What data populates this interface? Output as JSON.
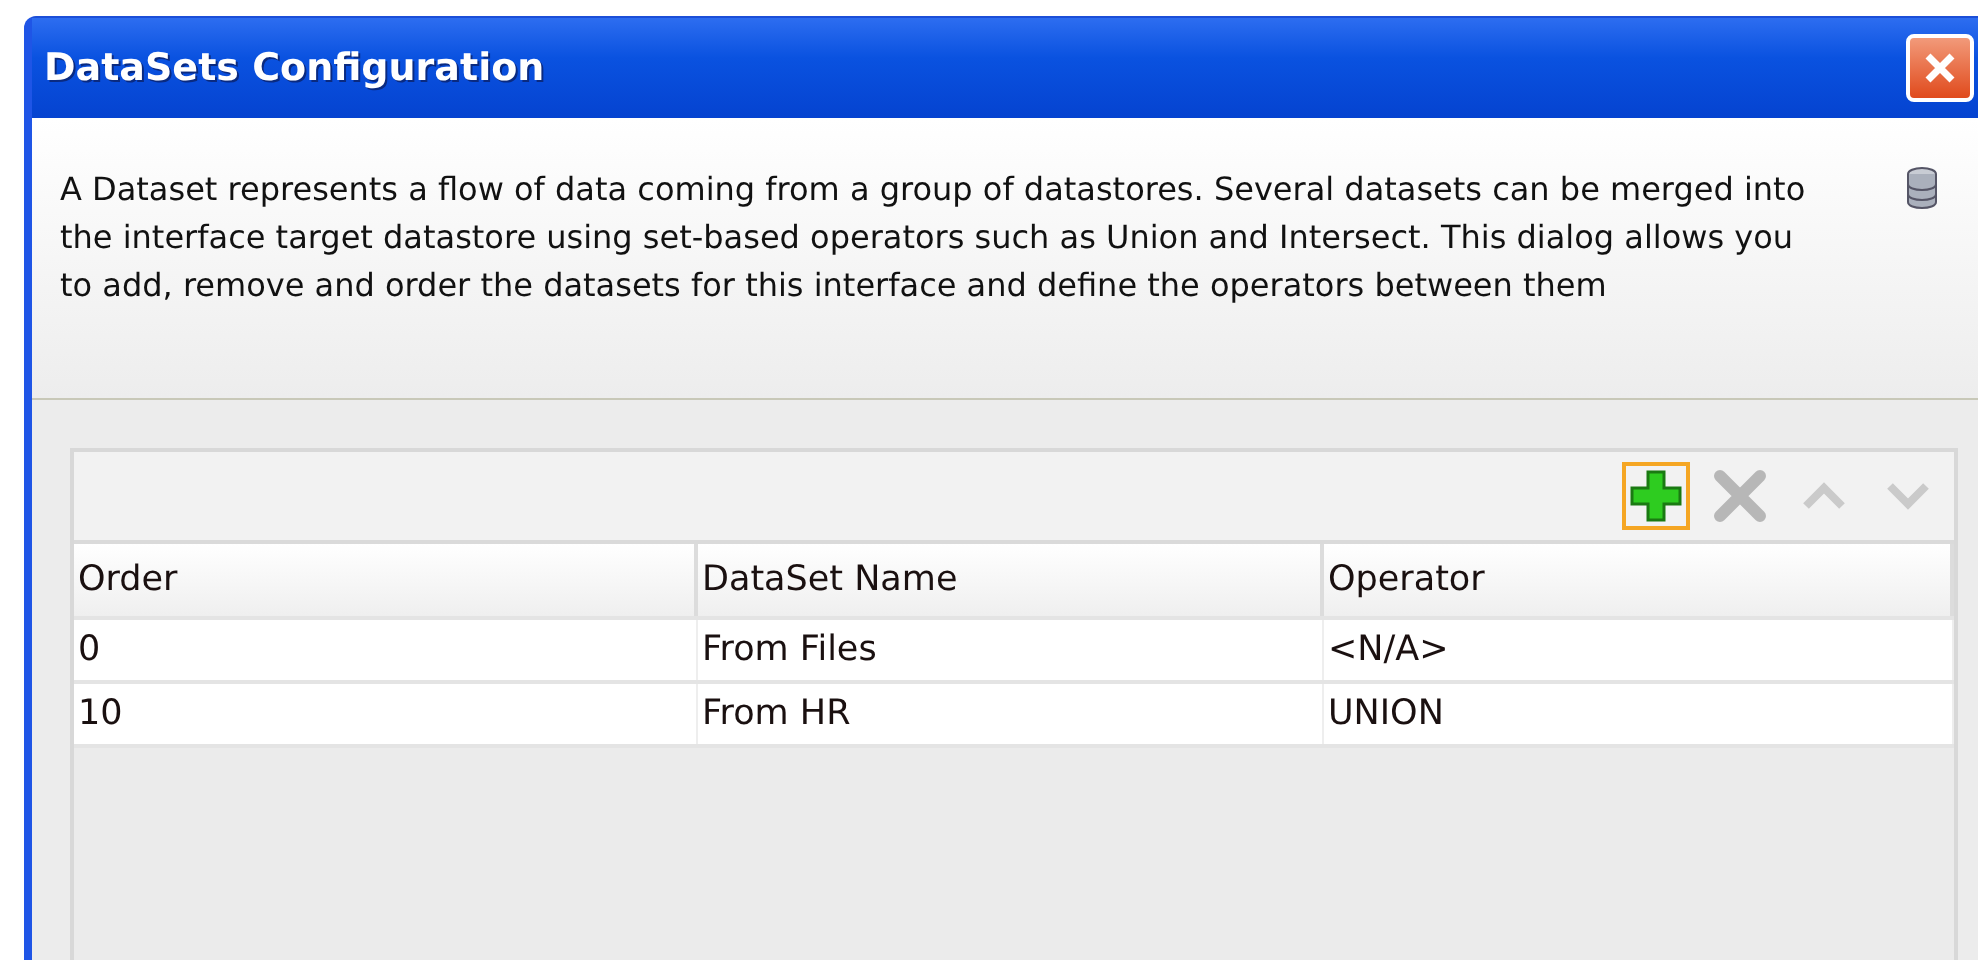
{
  "window": {
    "title": "DataSets Configuration"
  },
  "description": "A Dataset represents a flow of data coming from a group of datastores. Several datasets can be merged into the interface target datastore using set-based operators such as Union and Intersect. This dialog allows you to add, remove and order the datasets for this interface and define the operators between them",
  "toolbar": [
    {
      "kind": "add",
      "highlighted": true,
      "disabled": false
    },
    {
      "kind": "remove",
      "highlighted": false,
      "disabled": true
    },
    {
      "kind": "up",
      "highlighted": false,
      "disabled": true
    },
    {
      "kind": "down",
      "highlighted": false,
      "disabled": true
    }
  ],
  "table": {
    "columns": [
      "Order",
      "DataSet Name",
      "Operator"
    ],
    "rows": [
      [
        "0",
        "From Files",
        "<N/A>"
      ],
      [
        "10",
        "From HR",
        "UNION"
      ]
    ]
  }
}
